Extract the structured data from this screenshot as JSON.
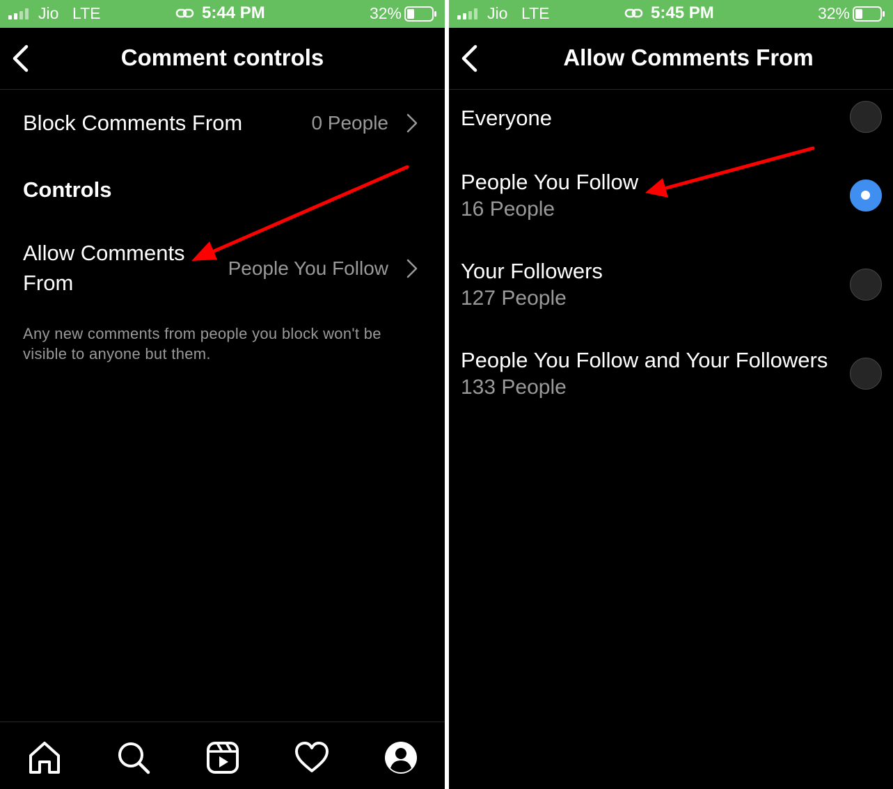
{
  "colors": {
    "status_bar": "#65bf5e",
    "background": "#000000",
    "selected_radio": "#3f8ef0",
    "annotation_arrow": "#ff0000"
  },
  "left_screen": {
    "status": {
      "carrier": "Jio",
      "network": "LTE",
      "time": "5:44 PM",
      "battery": "32%"
    },
    "header": {
      "title": "Comment controls"
    },
    "block_row": {
      "label": "Block Comments From",
      "value": "0 People"
    },
    "section_title": "Controls",
    "allow_row": {
      "label": "Allow Comments From",
      "value": "People You Follow"
    },
    "note": "Any new comments from people you block won't be visible to anyone but them.",
    "tabs": [
      "home-icon",
      "search-icon",
      "reels-icon",
      "heart-icon",
      "profile-icon"
    ]
  },
  "right_screen": {
    "status": {
      "carrier": "Jio",
      "network": "LTE",
      "time": "5:45 PM",
      "battery": "32%"
    },
    "header": {
      "title": "Allow Comments From"
    },
    "options": [
      {
        "label": "Everyone",
        "count": "",
        "selected": false
      },
      {
        "label": "People You Follow",
        "count": "16 People",
        "selected": true
      },
      {
        "label": "Your Followers",
        "count": "127 People",
        "selected": false
      },
      {
        "label": "People You Follow and Your Followers",
        "count": "133 People",
        "selected": false
      }
    ]
  }
}
